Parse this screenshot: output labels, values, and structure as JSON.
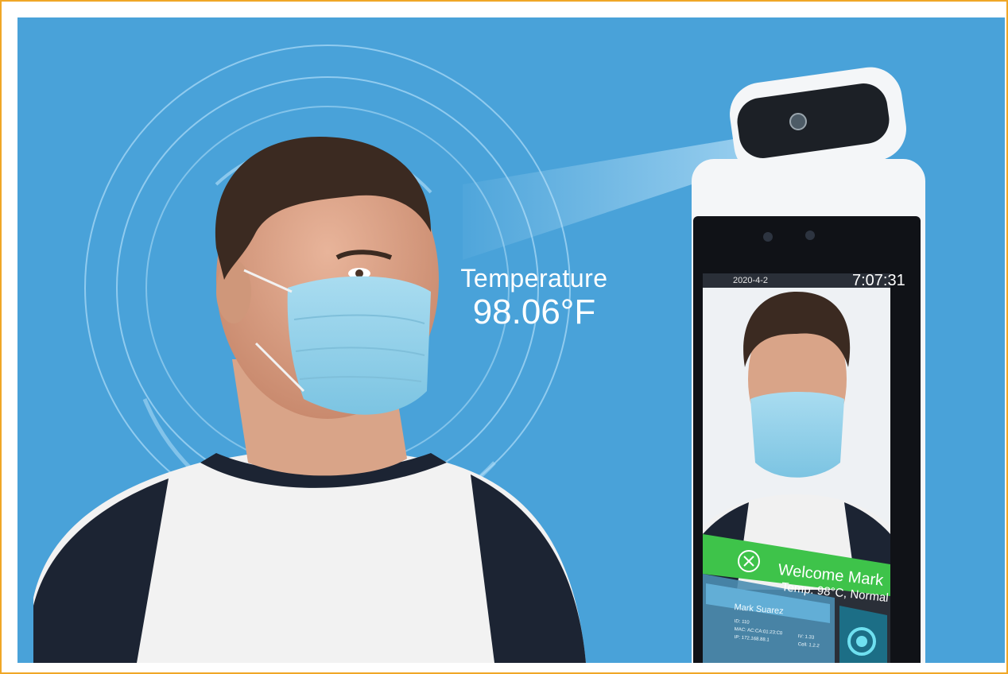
{
  "overlay": {
    "label": "Temperature",
    "value": "98.06°F"
  },
  "kiosk": {
    "date": "2020-4-2",
    "time": "7:07:31",
    "welcome": "Welcome Mark",
    "status": "Temp: 98°C, Normal",
    "person_name": "Mark Suarez",
    "info_lines": [
      "ID: 110",
      "MAC: AC:CA:01:23:C0",
      "IP: 172.168.88.1",
      "IV: 1.33",
      "Cell: 1.2.2"
    ]
  },
  "colors": {
    "frame_border": "#f0a726",
    "background_blue": "#49a2d9",
    "welcome_banner": "#3ec34a",
    "mask_blue": "#8fd0ea",
    "shirt_dark": "#1c2433",
    "device_white": "#f4f6f8"
  }
}
